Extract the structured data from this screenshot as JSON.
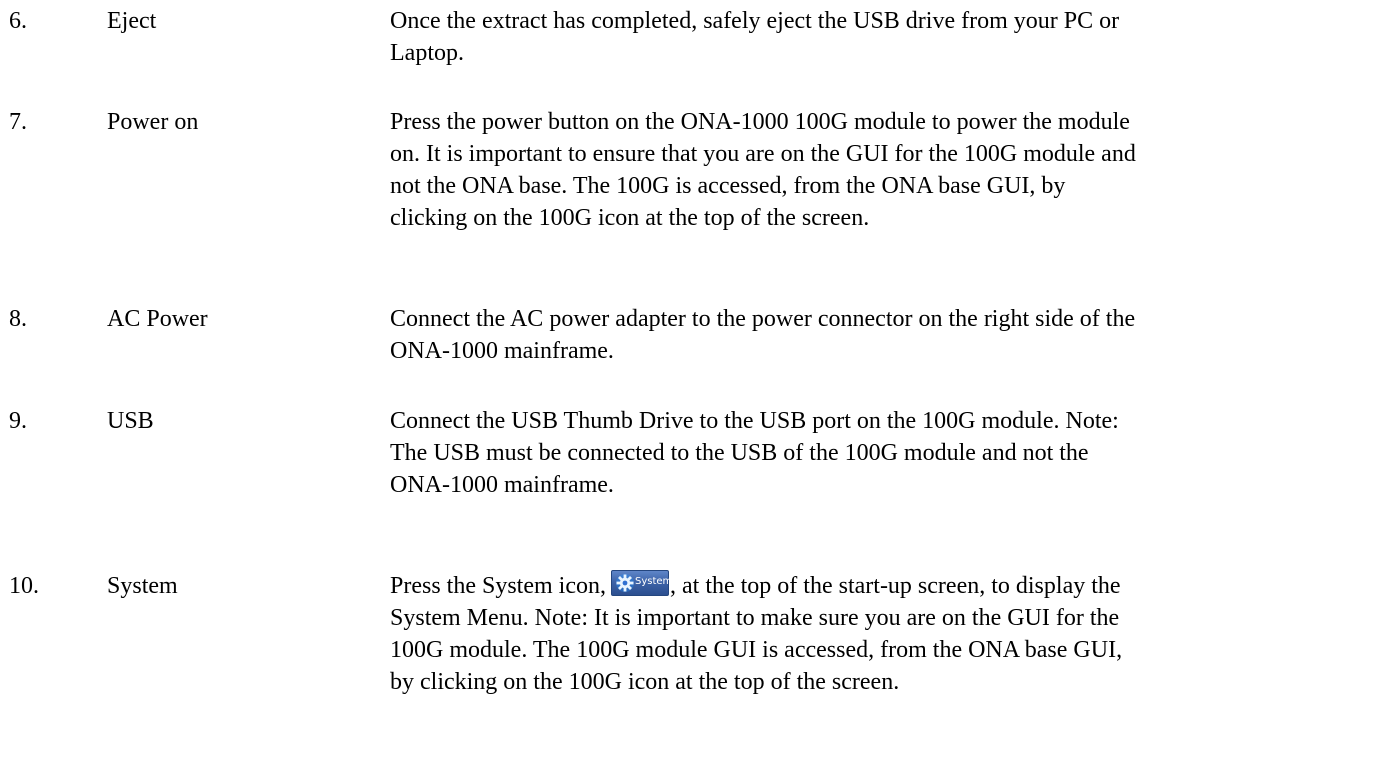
{
  "steps": [
    {
      "number": "6.",
      "label": "Eject",
      "lines": [
        "Once the extract has completed, safely eject the USB drive from your PC or",
        "Laptop."
      ]
    },
    {
      "number": "7.",
      "label": "Power on",
      "lines": [
        "Press the power button on the ONA-1000 100G module to power the module",
        "on. It is important to ensure that you are on the GUI for the 100G module and",
        "not the ONA base. The 100G is accessed, from the ONA base GUI, by",
        "clicking on the 100G icon at the top of the screen."
      ]
    },
    {
      "number": "8.",
      "label": "AC Power",
      "lines": [
        "Connect the AC power adapter to the power connector on the right side of the",
        "ONA-1000 mainframe."
      ]
    },
    {
      "number": "9.",
      "label": "USB",
      "lines": [
        "Connect the USB Thumb Drive to the USB port on the 100G module. Note:",
        "The USB must be connected to the USB of the 100G module and not the",
        "ONA-1000 mainframe."
      ]
    },
    {
      "number": "10.",
      "label": "System",
      "first_line_before_icon": "Press the System icon,",
      "icon_text": "System",
      "icon_name": "system-gear-icon",
      "first_line_after_icon": ", at the top of the start-up screen, to display the",
      "lines": [
        "System Menu. Note: It is important to make sure you are on the GUI for the",
        "100G module. The 100G module GUI is accessed, from the ONA base GUI,",
        "by clicking on the 100G icon at the top of the screen."
      ]
    }
  ],
  "colors": {
    "text": "#000000",
    "background": "#ffffff",
    "icon_blue": "#3d63a8"
  }
}
